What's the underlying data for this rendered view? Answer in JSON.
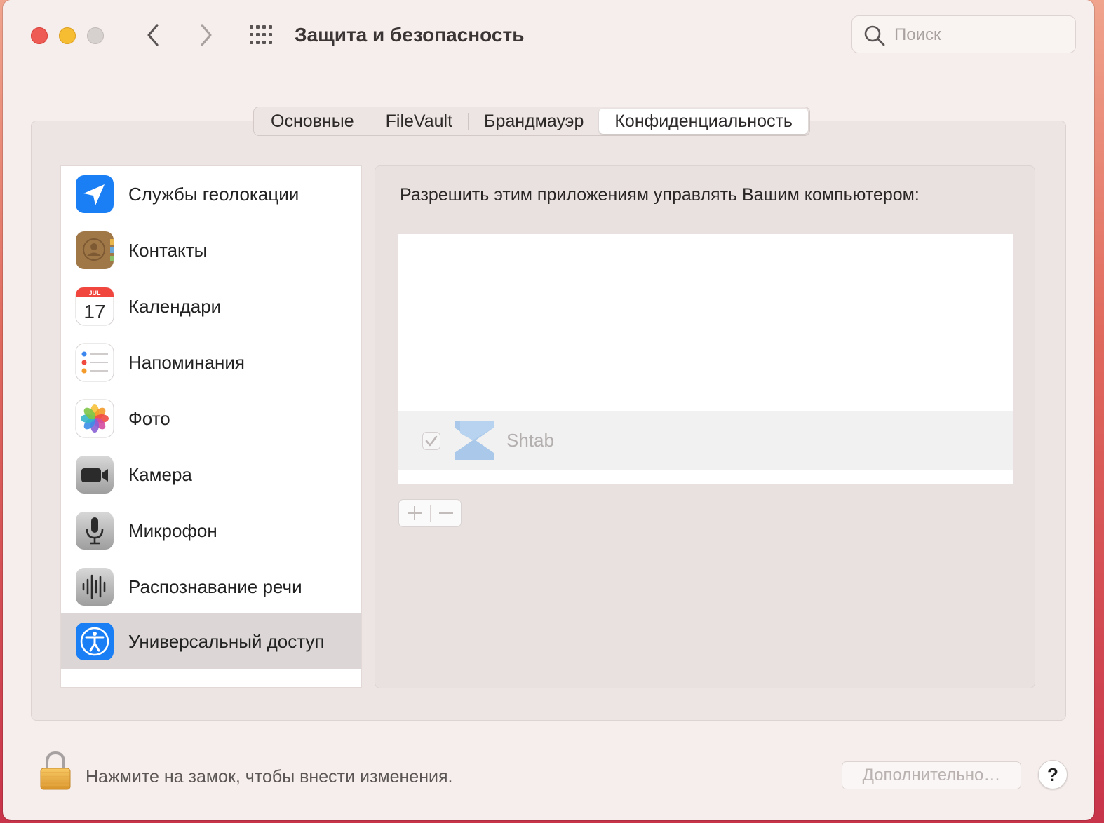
{
  "window": {
    "title": "Защита и безопасность",
    "search_placeholder": "Поиск"
  },
  "tabs": [
    {
      "label": "Основные",
      "active": false
    },
    {
      "label": "FileVault",
      "active": false
    },
    {
      "label": "Брандмауэр",
      "active": false
    },
    {
      "label": "Конфиденциальность",
      "active": true
    }
  ],
  "sidebar": {
    "items": [
      {
        "label": "Службы геолокации",
        "icon": "location-arrow-icon"
      },
      {
        "label": "Контакты",
        "icon": "contacts-icon"
      },
      {
        "label": "Календари",
        "icon": "calendar-icon",
        "month": "JUL",
        "day": "17"
      },
      {
        "label": "Напоминания",
        "icon": "reminders-icon"
      },
      {
        "label": "Фото",
        "icon": "photos-icon"
      },
      {
        "label": "Камера",
        "icon": "camera-icon"
      },
      {
        "label": "Микрофон",
        "icon": "microphone-icon"
      },
      {
        "label": "Распознавание речи",
        "icon": "speech-recognition-icon"
      },
      {
        "label": "Универсальный доступ",
        "icon": "accessibility-icon",
        "selected": true
      }
    ]
  },
  "panel": {
    "heading": "Разрешить этим приложениям управлять Вашим компьютером:",
    "apps": [
      {
        "name": "Shtab",
        "checked": true,
        "icon": "shtab-logo-icon"
      }
    ],
    "add_label": "+",
    "remove_label": "—"
  },
  "footer": {
    "lock_text": "Нажмите на замок, чтобы внести изменения.",
    "advanced_label": "Дополнительно…",
    "help_label": "?"
  },
  "colors": {
    "accent": "#1a7ff5",
    "selected_row": "#dcd7d6",
    "window_bg": "#f6eeec"
  }
}
